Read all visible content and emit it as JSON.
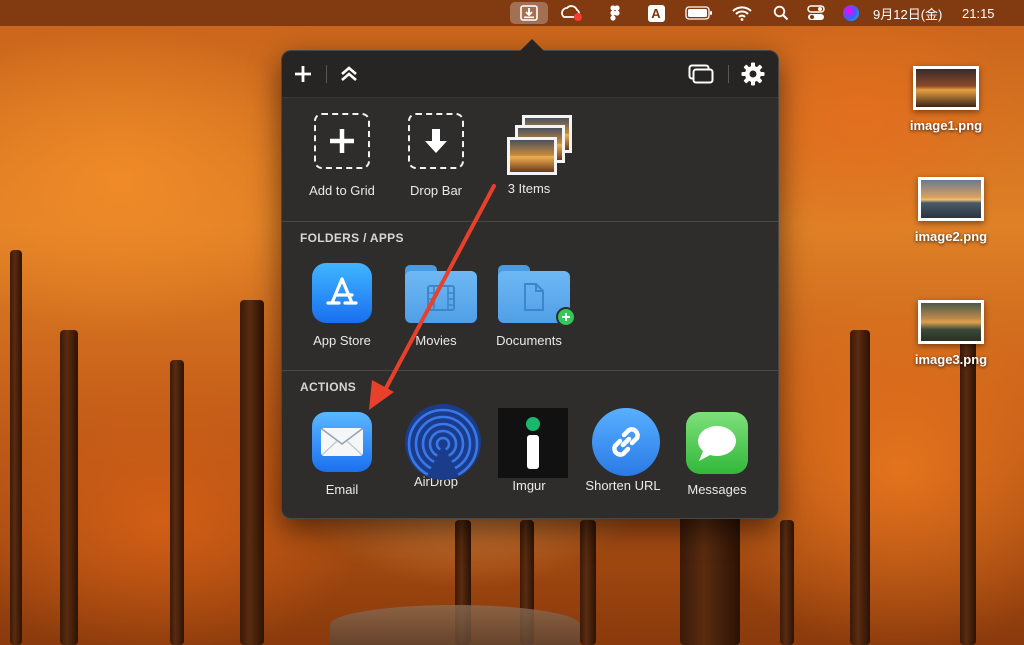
{
  "menubar": {
    "date_label": "9月12日(金)",
    "time_label": "21:15",
    "input_source_label": "A",
    "icons": [
      "dropzone-icon",
      "creative-cloud-icon",
      "figma-icon",
      "input-source-icon",
      "battery-icon",
      "wifi-icon",
      "spotlight-icon",
      "control-center-icon",
      "siri-icon"
    ]
  },
  "popup": {
    "toolbar": {
      "add_icon": "plus-icon",
      "collapse_icon": "chevron-up-double-icon",
      "window_icon": "window-icon",
      "settings_icon": "gear-icon"
    },
    "top_tiles": [
      {
        "label": "Add to Grid",
        "icon": "plus-icon"
      },
      {
        "label": "Drop Bar",
        "icon": "arrow-down-icon"
      },
      {
        "label": "3 Items",
        "icon": "photo-stack-icon"
      }
    ],
    "folders_section": {
      "title": "FOLDERS / APPS",
      "items": [
        {
          "label": "App Store",
          "icon": "app-store-icon"
        },
        {
          "label": "Movies",
          "icon": "movies-folder-icon"
        },
        {
          "label": "Documents",
          "icon": "documents-folder-icon"
        }
      ]
    },
    "actions_section": {
      "title": "ACTIONS",
      "items": [
        {
          "label": "Email",
          "icon": "mail-icon"
        },
        {
          "label": "AirDrop",
          "icon": "airdrop-icon"
        },
        {
          "label": "Imgur",
          "icon": "imgur-icon"
        },
        {
          "label": "Shorten URL",
          "icon": "link-icon"
        },
        {
          "label": "Messages",
          "icon": "messages-icon"
        }
      ]
    }
  },
  "desktop": {
    "files": [
      {
        "label": "image1.png"
      },
      {
        "label": "image2.png"
      },
      {
        "label": "image3.png"
      }
    ]
  },
  "colors": {
    "popup_bg": "#2e2d2c",
    "toolbar_bg": "#262524",
    "annotation_arrow": "#e8402a",
    "menubar_bg": "#78341099"
  }
}
